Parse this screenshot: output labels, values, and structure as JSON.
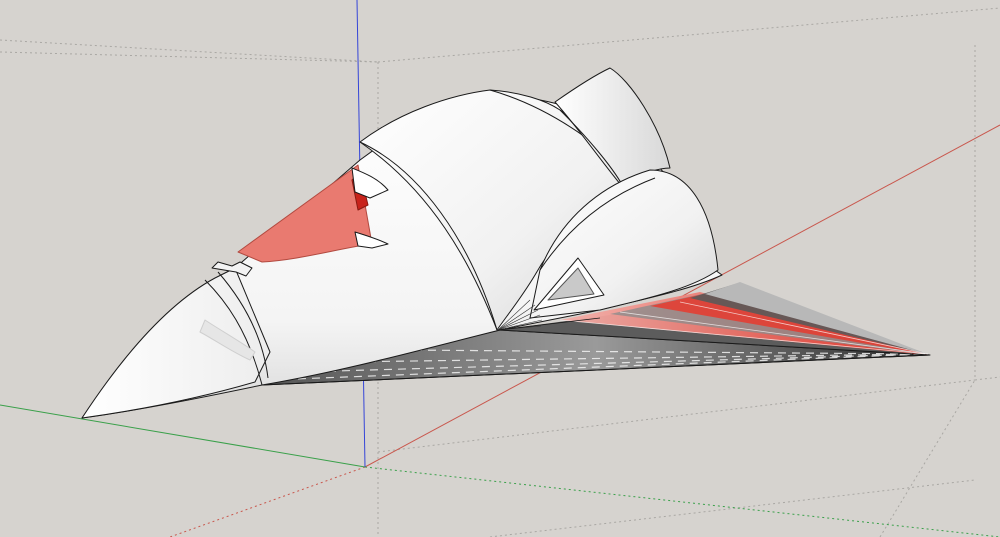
{
  "viewport": {
    "background": "#d6d3cf"
  },
  "axes": {
    "red_axis_color": "#c0392b",
    "green_axis_color": "#2e9e3a",
    "blue_axis_color": "#2f3fd8"
  },
  "model": {
    "surface_color": "#ffffff",
    "edge_color": "#1a1a1a",
    "back_face_color": "#e8786e",
    "underside_dark": "#3a3a3a",
    "underside_red": "#e83a2e"
  }
}
